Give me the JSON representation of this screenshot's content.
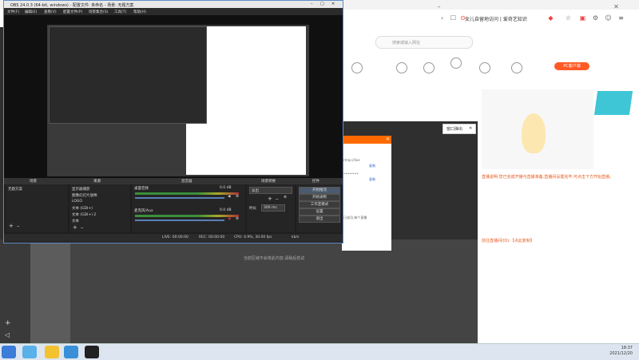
{
  "obs": {
    "title": "OBS 24.0.3 (64-bit, windows) - 配置文件: 未命名 - 场景: 无题方案",
    "menu": [
      "文件(F)",
      "编辑(E)",
      "查看(V)",
      "配置文件(P)",
      "场景集合(S)",
      "工具(T)",
      "帮助(H)"
    ],
    "docks": [
      "场景",
      "来源",
      "混音器",
      "场景转换",
      "控件"
    ],
    "scenes": [
      "无题方案"
    ],
    "sources": [
      "显示器捕获",
      "图像幻灯片放映",
      "LOGO",
      "文本 (GDI+)",
      "文本 (GDI+) 2",
      "文本"
    ],
    "mixer": {
      "track1": "桌面音频",
      "track2": "麦克风/Aux",
      "db1": "0.0 dB",
      "db2": "0.0 dB"
    },
    "transition": {
      "type": "淡出",
      "duration_label": "时长",
      "duration_value": "300 ms"
    },
    "controls": [
      "开始推流",
      "开始录制",
      "工作室模式",
      "设置",
      "退出"
    ],
    "status": {
      "live": "LIVE: 00:00:00",
      "rec": "REC: 00:00:00",
      "cpu": "CPU: 4.9%, 30.00 fps",
      "bitrate": "kb/s"
    },
    "hint": "当前区域不会将此内容,请稍后尝试"
  },
  "browser": {
    "address": "女儿自留地访问 | 爱奇艺知识",
    "search_placeholder": "搜索或输入网址",
    "pc_button": "PC客户端",
    "popup_title": "窗口弹出",
    "description": "直播说明:您已完成开播与直播准备,直播间设置完毕,可点击下方开始直播。",
    "link": "前往直播间(ID):【点此复制】",
    "dialog_lines": [
      "rtmp://live",
      "复制",
      "••••••••",
      "复制",
      "已成功,每个直播"
    ]
  },
  "taskbar": {
    "time": "18:37",
    "date": "2021/12/20"
  }
}
